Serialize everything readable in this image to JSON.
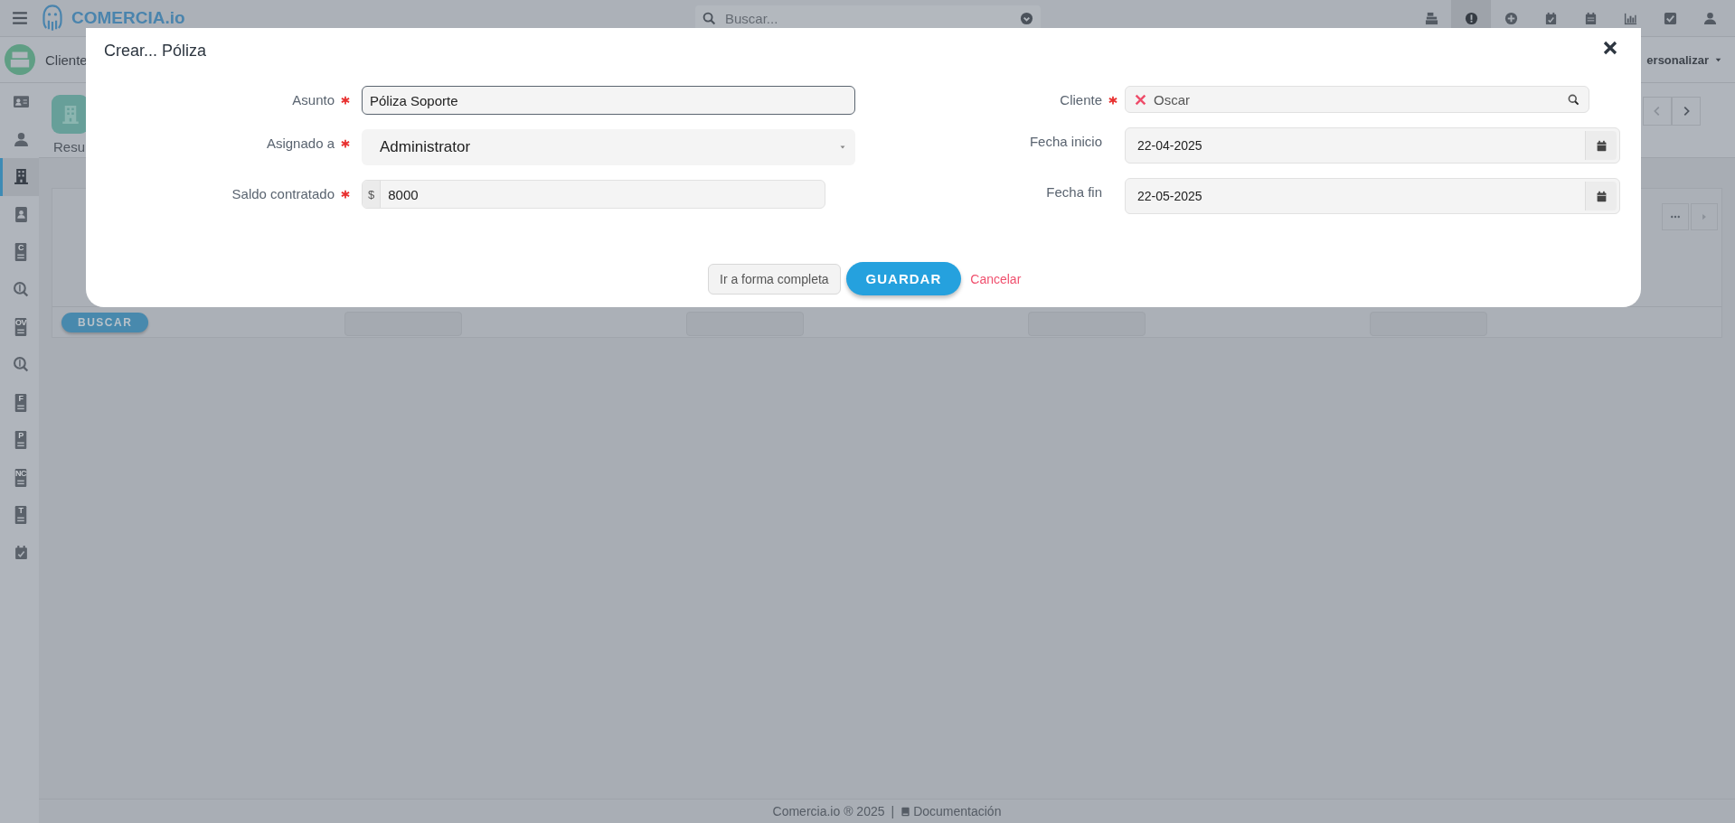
{
  "topbar": {
    "logo": "COMERCIA.io",
    "search": {
      "placeholder": "Buscar..."
    },
    "icons": [
      {
        "kind": "register",
        "selected": false
      },
      {
        "kind": "alert",
        "selected": true
      },
      {
        "kind": "plus",
        "selected": false
      },
      {
        "kind": "calendar-check",
        "selected": false
      },
      {
        "kind": "calendar",
        "selected": false
      },
      {
        "kind": "chart",
        "selected": false
      },
      {
        "kind": "check",
        "selected": false
      },
      {
        "kind": "user",
        "selected": false
      }
    ]
  },
  "subheader": {
    "title": "Cliente",
    "customize": "ersonalizar"
  },
  "sidebar": {
    "items": [
      {
        "kind": "card",
        "selected": false
      },
      {
        "kind": "user",
        "selected": false
      },
      {
        "kind": "building",
        "selected": true
      },
      {
        "kind": "contacts",
        "selected": false
      },
      {
        "kind": "doc",
        "letter": "C",
        "selected": false
      },
      {
        "kind": "money-search",
        "selected": false
      },
      {
        "kind": "doc",
        "letter": "OV",
        "selected": false
      },
      {
        "kind": "money-search",
        "selected": false
      },
      {
        "kind": "doc",
        "letter": "F",
        "selected": false
      },
      {
        "kind": "doc",
        "letter": "P",
        "selected": false
      },
      {
        "kind": "doc",
        "letter": "NC",
        "selected": false
      },
      {
        "kind": "doc",
        "letter": "T",
        "selected": false
      },
      {
        "kind": "calendar-check",
        "selected": false
      }
    ]
  },
  "main": {
    "tab": "Resu",
    "search_button": "BUSCAR"
  },
  "modal": {
    "title": "Crear... Póliza",
    "columns": [
      [
        {
          "label": "Asunto",
          "required": true,
          "kind": "text",
          "value": "Póliza Soporte",
          "focused": true
        },
        {
          "label": "Asignado a",
          "required": true,
          "kind": "select",
          "value": "Administrator"
        },
        {
          "label": "Saldo contratado",
          "required": true,
          "kind": "currency",
          "prefix": "$",
          "value": "8000"
        }
      ],
      [
        {
          "label": "Cliente",
          "required": true,
          "kind": "lookup",
          "value": "Oscar"
        },
        {
          "label": "Fecha inicio",
          "required": false,
          "kind": "date",
          "value": "22-04-2025"
        },
        {
          "label": "Fecha fin",
          "required": false,
          "kind": "date",
          "value": "22-05-2025"
        }
      ]
    ],
    "actions": {
      "full_form": "Ir a forma completa",
      "save": "GUARDAR",
      "cancel": "Cancelar"
    }
  },
  "footer": {
    "copyright": "Comercia.io ® 2025",
    "separator": "|",
    "docs": "Documentación"
  }
}
